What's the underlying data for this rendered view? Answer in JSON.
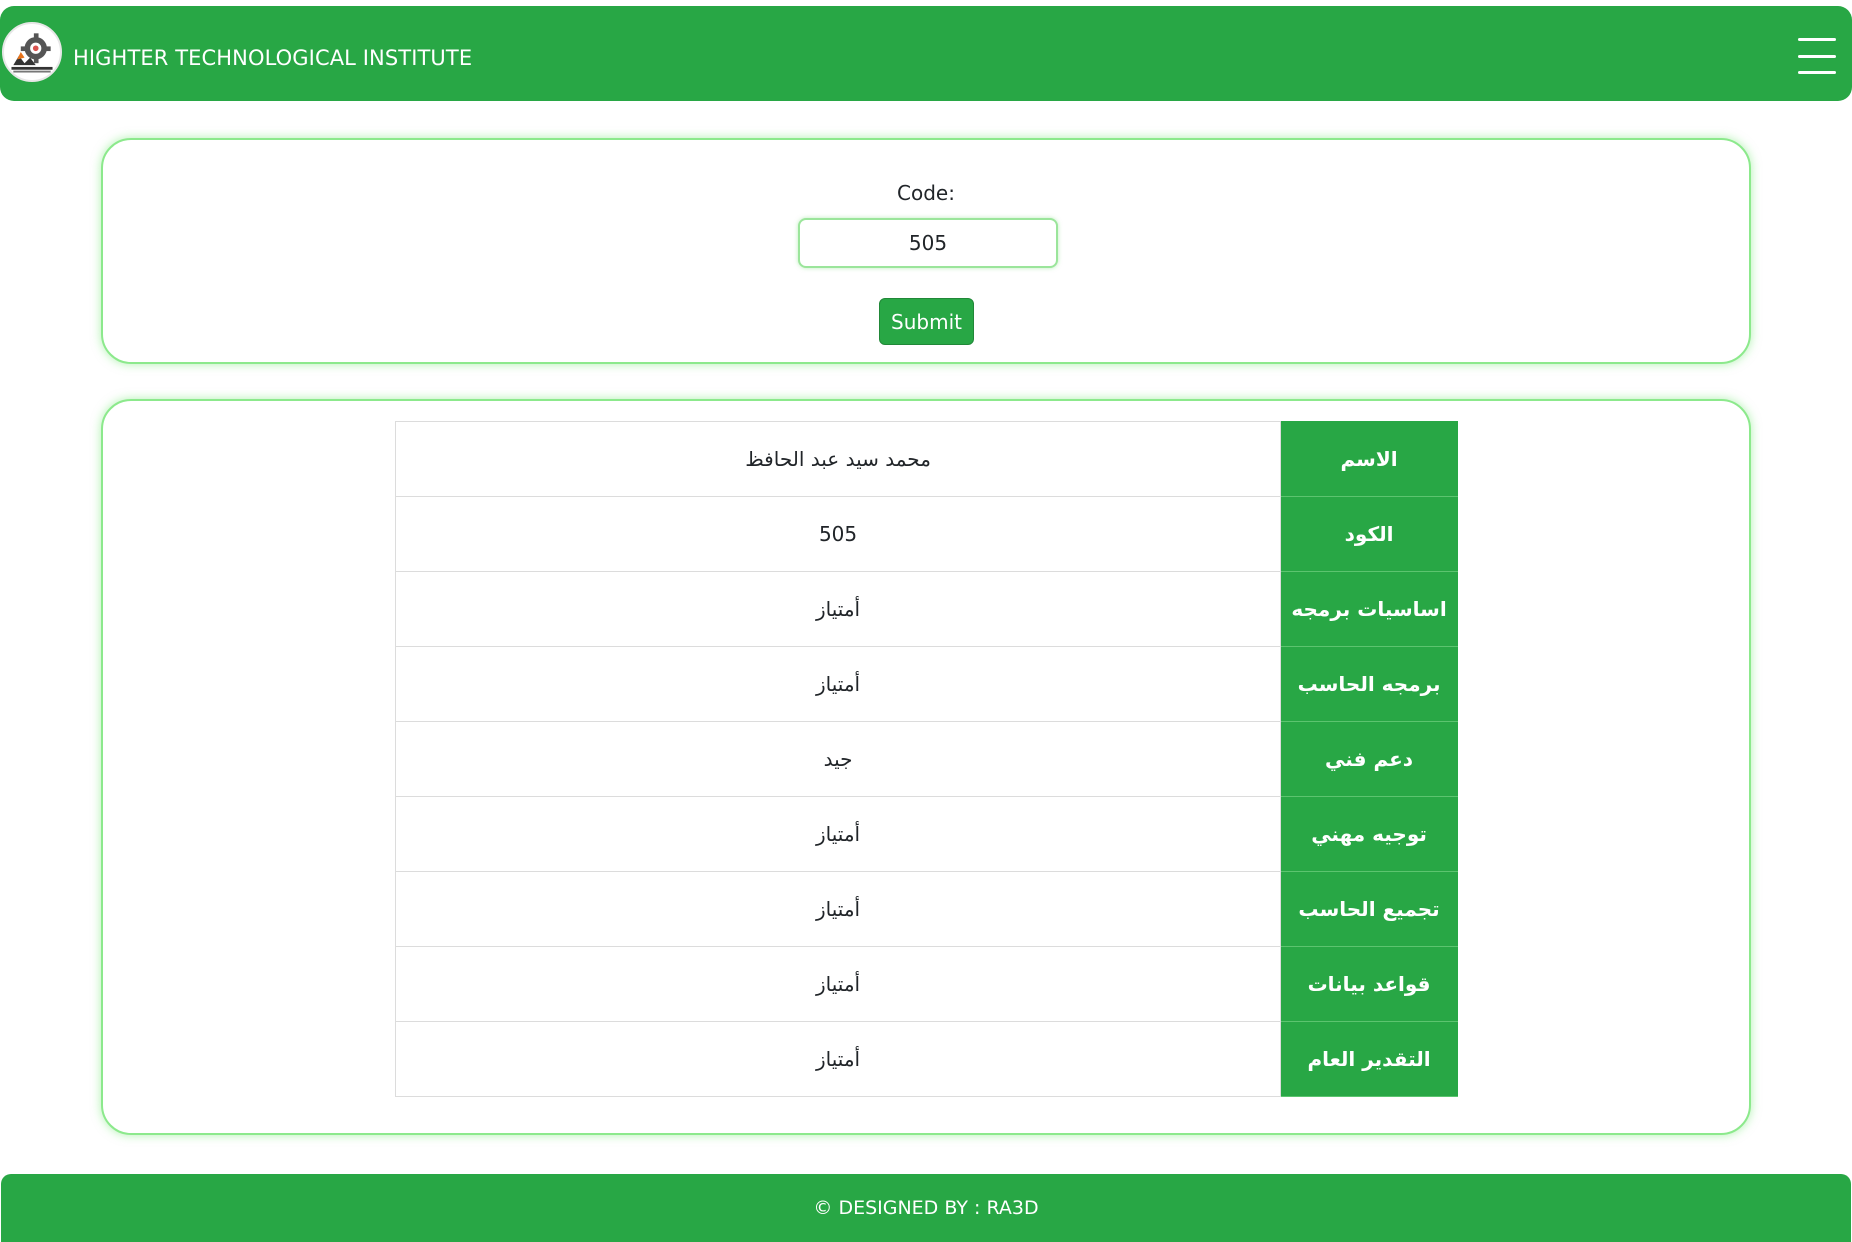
{
  "navbar": {
    "brand": "HIGHTER TECHNOLOGICAL INSTITUTE",
    "logo_icon": "institute-gear-logo",
    "menu_icon": "hamburger-menu-icon",
    "background_color": "#28a745"
  },
  "form": {
    "code_label": "Code:",
    "code_value": "505",
    "submit_label": "Submit"
  },
  "results": {
    "rows": [
      {
        "subject": "الاسم",
        "value": "محمد سيد عبد الحافظ"
      },
      {
        "subject": "الكود",
        "value": "505"
      },
      {
        "subject": "اساسيات برمجه",
        "value": "أمتياز"
      },
      {
        "subject": "برمجه الحاسب",
        "value": "أمتياز"
      },
      {
        "subject": "دعم فني",
        "value": "جيد"
      },
      {
        "subject": "توجيه مهني",
        "value": "أمتياز"
      },
      {
        "subject": "تجميع الحاسب",
        "value": "أمتياز"
      },
      {
        "subject": "قواعد بيانات",
        "value": "أمتياز"
      },
      {
        "subject": "التقدير العام",
        "value": "أمتياز"
      }
    ]
  },
  "footer": {
    "text": "© DESIGNED BY : RA3D"
  }
}
